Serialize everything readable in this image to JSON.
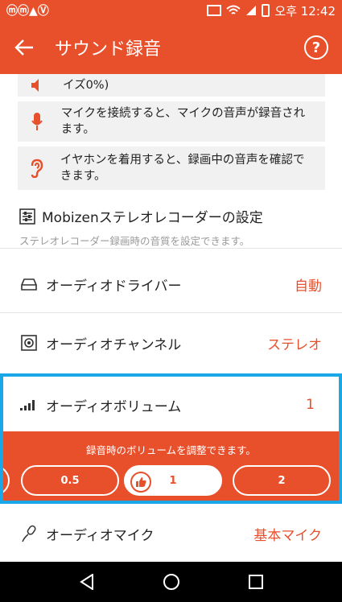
{
  "status_bar": {
    "time": "오후 12:42",
    "left_icons": "ⓜⓜ▲Ⓥ"
  },
  "app_bar": {
    "title": "サウンド録音",
    "back_icon": "arrow-left-icon",
    "help_label": "?"
  },
  "info_items": [
    {
      "icon": "speaker-icon",
      "text": "イズ0%)"
    },
    {
      "icon": "microphone-icon",
      "text": "マイクを接続すると、マイクの音声が録音されます。"
    },
    {
      "icon": "ear-icon",
      "text": "イヤホンを着用すると、録画中の音声を確認できます。"
    }
  ],
  "stereo_recorder": {
    "title": "Mobizenステレオレコーダーの設定",
    "subtitle": "ステレオレコーダー録画時の音質を設定できます。"
  },
  "settings": [
    {
      "label": "オーディオドライバー",
      "value": "自動",
      "icon": "drive-icon"
    },
    {
      "label": "オーディオチャンネル",
      "value": "ステレオ",
      "icon": "speaker-box-icon"
    },
    {
      "label": "オーディオボリューム",
      "value": "1",
      "icon": "signal-bars-icon"
    },
    {
      "label": "オーディオマイク",
      "value": "基本マイク",
      "icon": "microphone-outline-icon"
    }
  ],
  "volume_panel": {
    "description": "録音時のボリュームを調整できます。",
    "options": [
      "0.5",
      "1",
      "2"
    ],
    "selected": "1"
  },
  "colors": {
    "accent": "#e8502c",
    "highlight": "#1aa7e8"
  }
}
